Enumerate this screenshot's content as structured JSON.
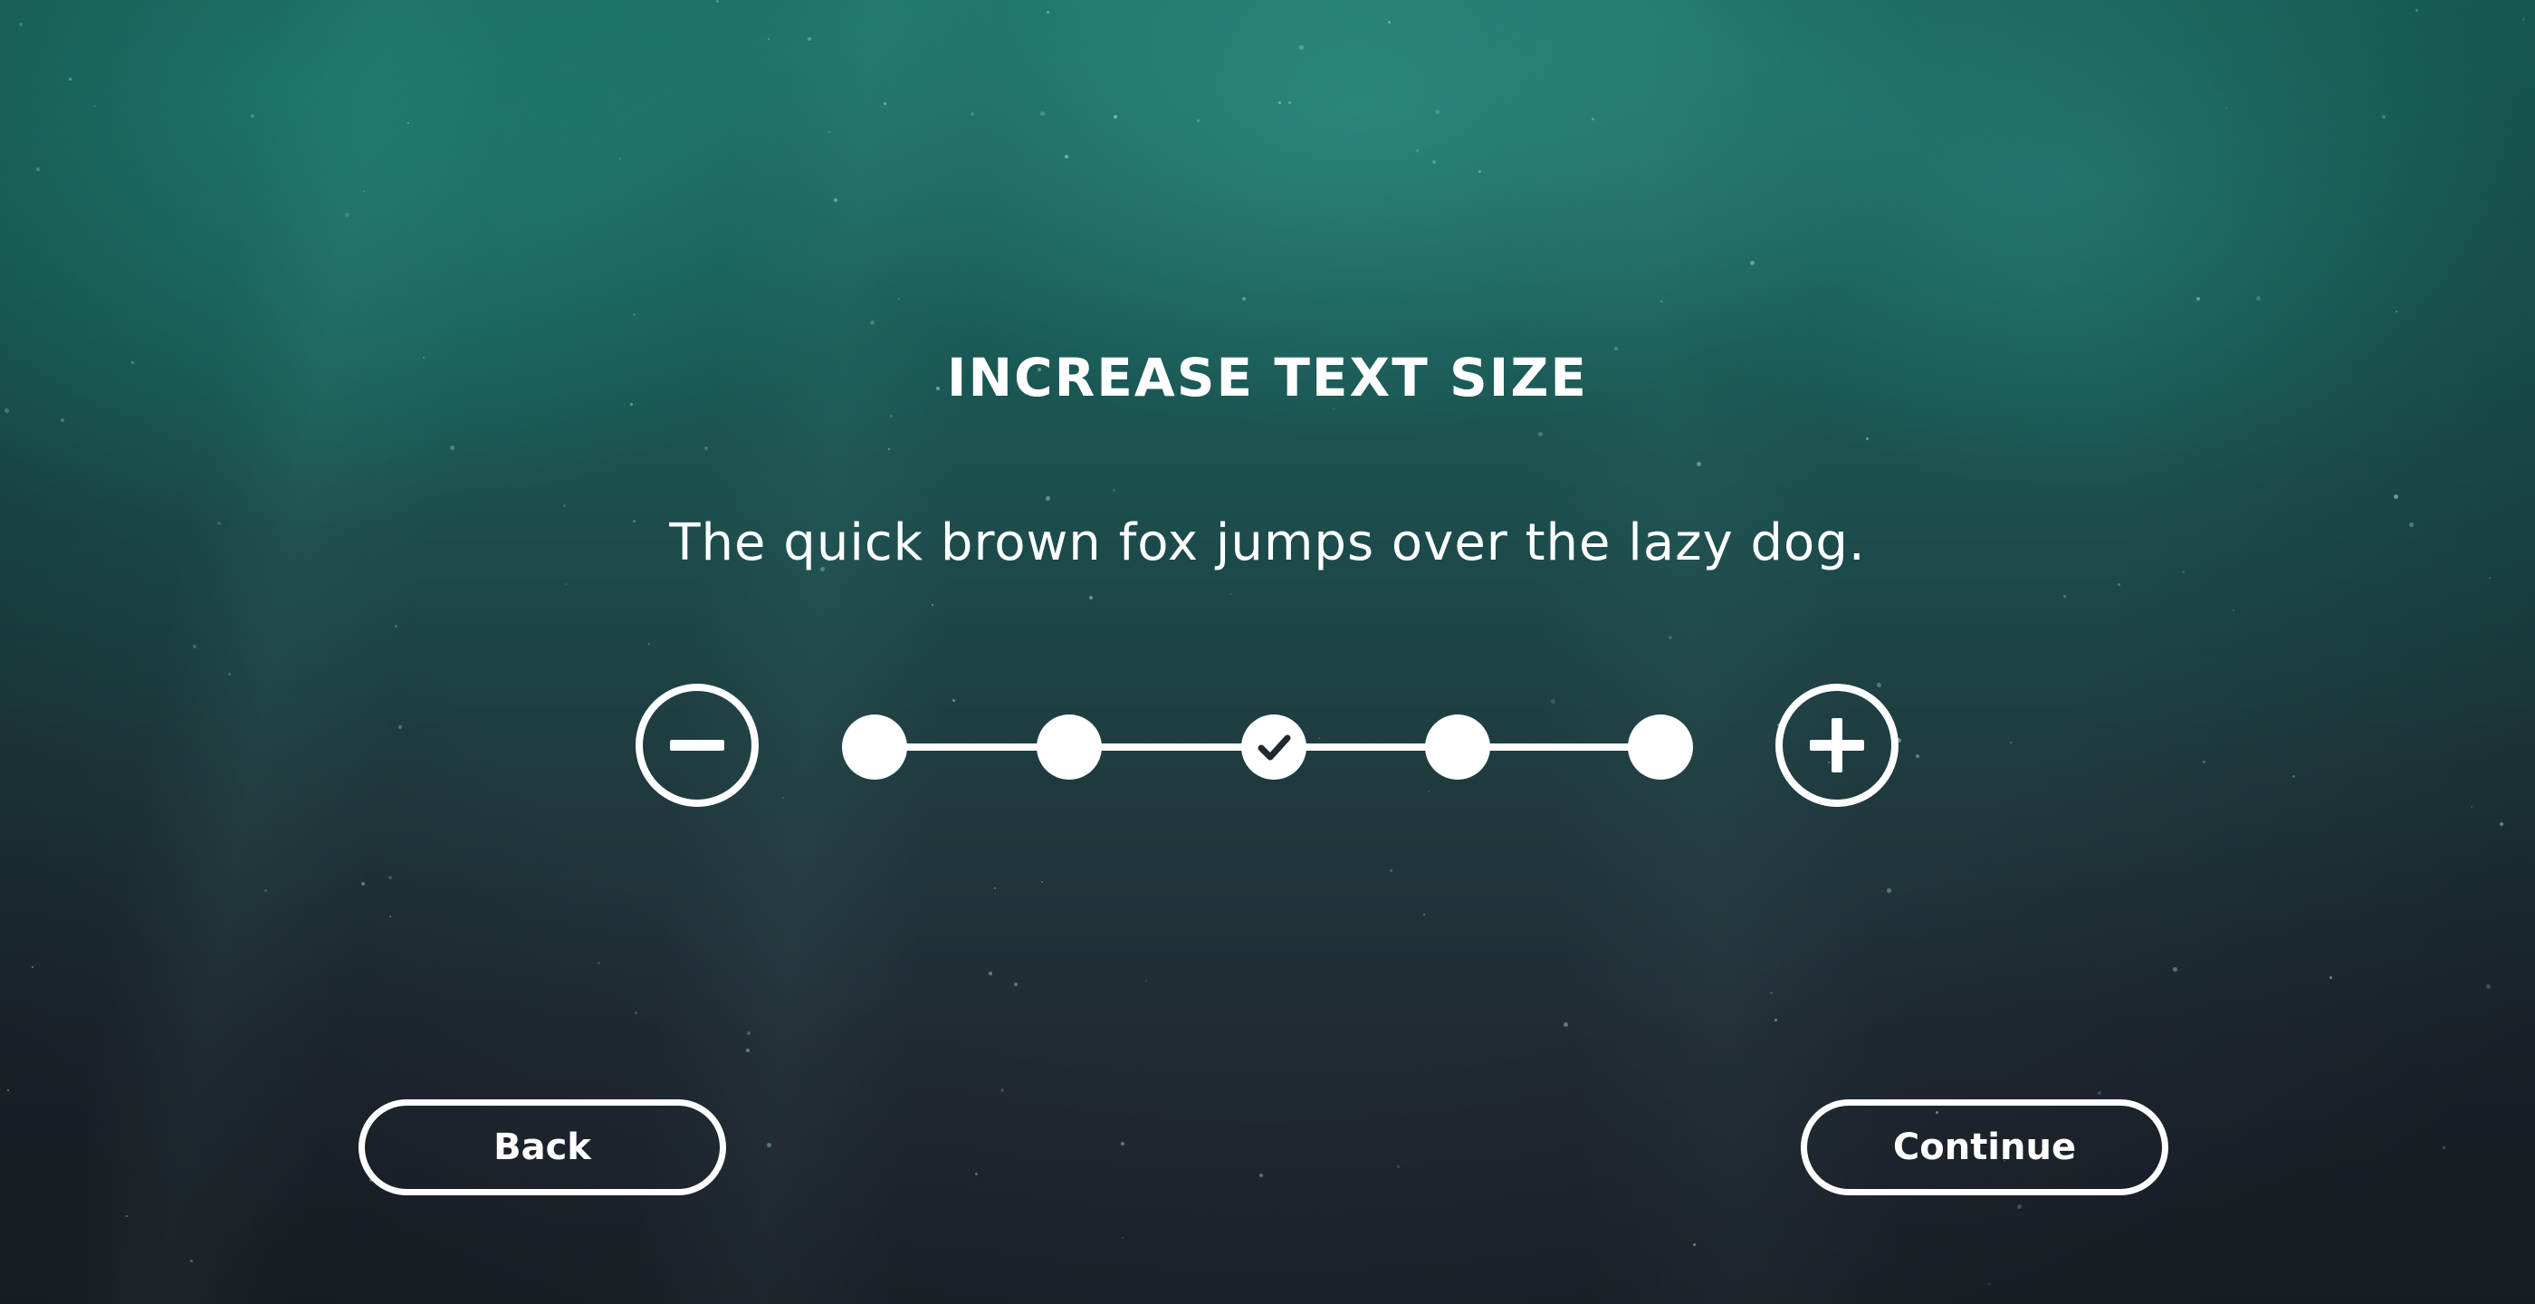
{
  "screen": {
    "title": "INCREASE TEXT SIZE",
    "sample_text": "The quick brown fox jumps over the lazy dog."
  },
  "text_size": {
    "decrease_icon": "minus-circle-icon",
    "increase_icon": "plus-circle-icon",
    "steps": 5,
    "selected_step": 3,
    "selected_icon": "checkmark-icon"
  },
  "nav": {
    "back_label": "Back",
    "continue_label": "Continue"
  },
  "colors": {
    "foreground": "#ffffff",
    "background_top": "#1d6f67",
    "background_bottom": "#20252e"
  }
}
